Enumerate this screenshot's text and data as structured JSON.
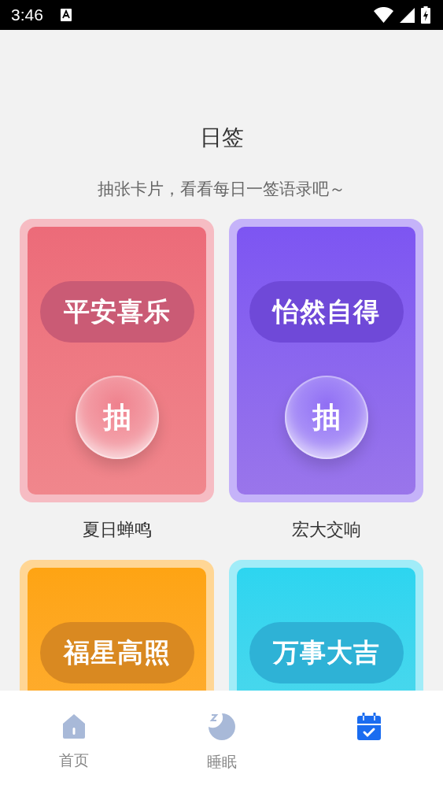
{
  "status_bar": {
    "time": "3:46"
  },
  "header": {
    "title": "日签",
    "subtitle": "抽张卡片，看看每日一签语录吧～"
  },
  "cards": [
    {
      "title": "平安喜乐",
      "draw_label": "抽",
      "caption": "夏日蝉鸣",
      "color": "#ec6b79"
    },
    {
      "title": "怡然自得",
      "draw_label": "抽",
      "caption": "宏大交响",
      "color": "#7d55f2"
    },
    {
      "title": "福星高照",
      "color": "#fea413"
    },
    {
      "title": "万事大吉",
      "color": "#2dd5f0"
    }
  ],
  "bottom_nav": [
    {
      "kind": "home",
      "label": "首页",
      "selected": false
    },
    {
      "kind": "sleep",
      "label": "睡眠",
      "selected": false
    },
    {
      "kind": "calendar",
      "selected": true
    }
  ]
}
